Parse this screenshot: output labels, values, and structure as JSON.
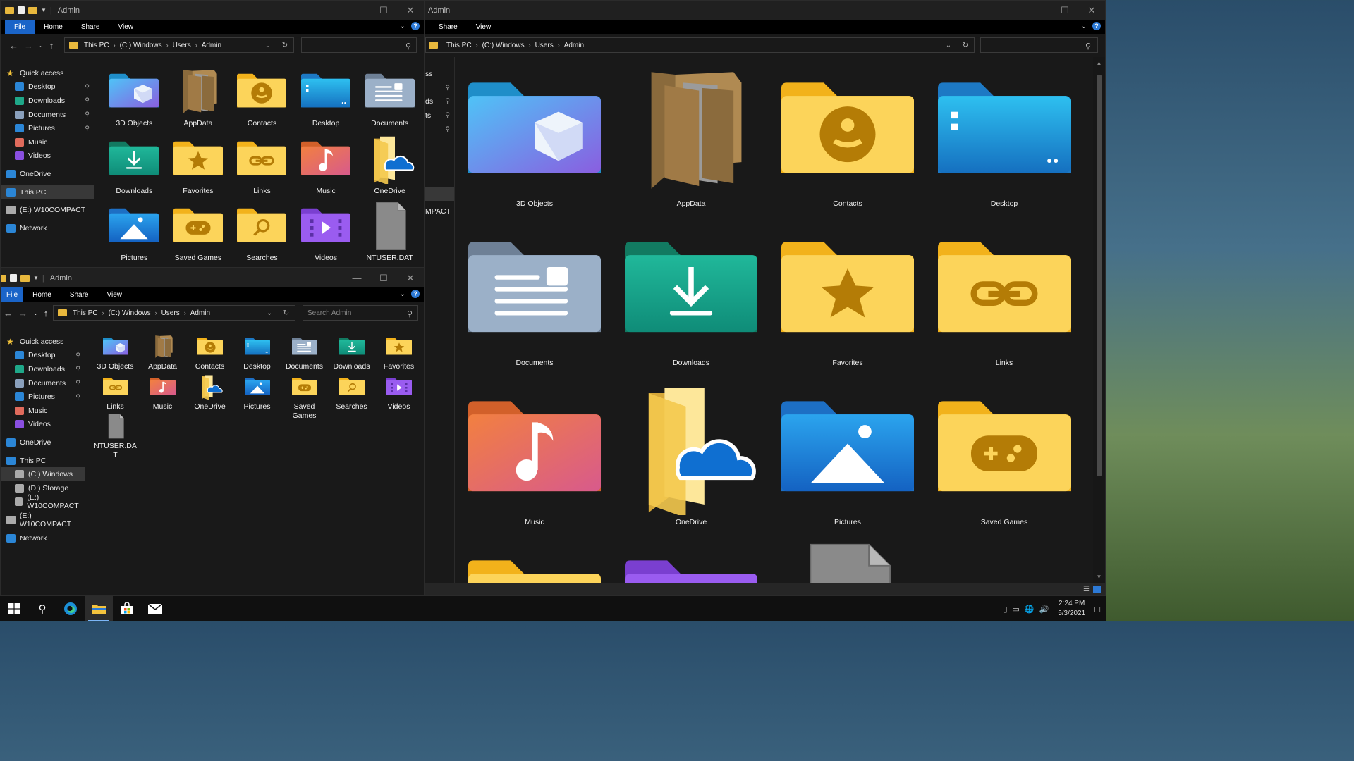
{
  "windows": {
    "w1": {
      "title": "Admin",
      "tabs": [
        "File",
        "Home",
        "Share",
        "View"
      ],
      "crumbs": [
        "This PC",
        "(C:) Windows",
        "Users",
        "Admin"
      ],
      "search_placeholder": ""
    },
    "w2": {
      "title": "Admin",
      "tabs": [
        "File",
        "Home",
        "Share",
        "View"
      ],
      "crumbs": [
        "This PC",
        "(C:) Windows",
        "Users",
        "Admin"
      ],
      "search_placeholder": "Search Admin"
    },
    "w3": {
      "title": "Admin",
      "tabs": [
        "Share",
        "View"
      ],
      "crumbs": [
        "This PC",
        "(C:) Windows",
        "Users",
        "Admin"
      ],
      "search_placeholder": ""
    }
  },
  "sidebar1": [
    {
      "label": "Quick access",
      "icon": "star-icon",
      "color": "#f3c33a",
      "indent": 0,
      "pin": false,
      "sel": false
    },
    {
      "label": "Desktop",
      "icon": "desktop-icon",
      "color": "#2b86d6",
      "indent": 1,
      "pin": true,
      "sel": false
    },
    {
      "label": "Downloads",
      "icon": "download-icon",
      "color": "#1fa889",
      "indent": 1,
      "pin": true,
      "sel": false
    },
    {
      "label": "Documents",
      "icon": "document-icon",
      "color": "#8aa0bc",
      "indent": 1,
      "pin": true,
      "sel": false
    },
    {
      "label": "Pictures",
      "icon": "picture-icon",
      "color": "#2b86d6",
      "indent": 1,
      "pin": true,
      "sel": false
    },
    {
      "label": "Music",
      "icon": "music-icon",
      "color": "#e06b5c",
      "indent": 1,
      "pin": false,
      "sel": false
    },
    {
      "label": "Videos",
      "icon": "video-icon",
      "color": "#8a4fe0",
      "indent": 1,
      "pin": false,
      "sel": false
    },
    {
      "gap": true
    },
    {
      "label": "OneDrive",
      "icon": "cloud-icon",
      "color": "#2b86d6",
      "indent": 0,
      "pin": false,
      "sel": false
    },
    {
      "gap": true
    },
    {
      "label": "This PC",
      "icon": "computer-icon",
      "color": "#2b86d6",
      "indent": 0,
      "pin": false,
      "sel": true
    },
    {
      "gap": true
    },
    {
      "label": "(E:) W10COMPACT",
      "icon": "drive-icon",
      "color": "#aaaaaa",
      "indent": 0,
      "pin": false,
      "sel": false
    },
    {
      "gap": true
    },
    {
      "label": "Network",
      "icon": "network-icon",
      "color": "#2b86d6",
      "indent": 0,
      "pin": false,
      "sel": false
    }
  ],
  "sidebar2": [
    {
      "label": "Quick access",
      "icon": "star-icon",
      "color": "#f3c33a",
      "indent": 0,
      "pin": false,
      "sel": false
    },
    {
      "label": "Desktop",
      "icon": "desktop-icon",
      "color": "#2b86d6",
      "indent": 1,
      "pin": true,
      "sel": false
    },
    {
      "label": "Downloads",
      "icon": "download-icon",
      "color": "#1fa889",
      "indent": 1,
      "pin": true,
      "sel": false
    },
    {
      "label": "Documents",
      "icon": "document-icon",
      "color": "#8aa0bc",
      "indent": 1,
      "pin": true,
      "sel": false
    },
    {
      "label": "Pictures",
      "icon": "picture-icon",
      "color": "#2b86d6",
      "indent": 1,
      "pin": true,
      "sel": false
    },
    {
      "label": "Music",
      "icon": "music-icon",
      "color": "#e06b5c",
      "indent": 1,
      "pin": false,
      "sel": false
    },
    {
      "label": "Videos",
      "icon": "video-icon",
      "color": "#8a4fe0",
      "indent": 1,
      "pin": false,
      "sel": false
    },
    {
      "gap": true
    },
    {
      "label": "OneDrive",
      "icon": "cloud-icon",
      "color": "#2b86d6",
      "indent": 0,
      "pin": false,
      "sel": false
    },
    {
      "gap": true
    },
    {
      "label": "This PC",
      "icon": "computer-icon",
      "color": "#2b86d6",
      "indent": 0,
      "pin": false,
      "sel": false
    },
    {
      "label": "(C:) Windows",
      "icon": "drive-icon",
      "color": "#aaaaaa",
      "indent": 1,
      "pin": false,
      "sel": true
    },
    {
      "label": "(D:) Storage",
      "icon": "drive-icon",
      "color": "#aaaaaa",
      "indent": 1,
      "pin": false,
      "sel": false
    },
    {
      "label": "(E:) W10COMPACT",
      "icon": "drive-icon",
      "color": "#aaaaaa",
      "indent": 1,
      "pin": false,
      "sel": false
    },
    {
      "gap": true
    },
    {
      "label": "(E:) W10COMPACT",
      "icon": "drive-icon",
      "color": "#aaaaaa",
      "indent": 0,
      "pin": false,
      "sel": false
    },
    {
      "gap": true
    },
    {
      "label": "Network",
      "icon": "network-icon",
      "color": "#2b86d6",
      "indent": 0,
      "pin": false,
      "sel": false
    }
  ],
  "sidebar3_fragments": [
    "ss",
    "ds",
    "ts",
    "MPACT"
  ],
  "files1": [
    {
      "label": "3D Objects",
      "kind": "3d"
    },
    {
      "label": "AppData",
      "kind": "appdata"
    },
    {
      "label": "Contacts",
      "kind": "contacts"
    },
    {
      "label": "Desktop",
      "kind": "desktop"
    },
    {
      "label": "Documents",
      "kind": "documents"
    },
    {
      "label": "Downloads",
      "kind": "downloads"
    },
    {
      "label": "Favorites",
      "kind": "favorites"
    },
    {
      "label": "Links",
      "kind": "links"
    },
    {
      "label": "Music",
      "kind": "music"
    },
    {
      "label": "OneDrive",
      "kind": "onedrive"
    },
    {
      "label": "Pictures",
      "kind": "pictures"
    },
    {
      "label": "Saved Games",
      "kind": "savedgames"
    },
    {
      "label": "Searches",
      "kind": "searches"
    },
    {
      "label": "Videos",
      "kind": "videos"
    },
    {
      "label": "NTUSER.DAT",
      "kind": "file"
    }
  ],
  "files2": [
    {
      "label": "3D Objects",
      "kind": "3d"
    },
    {
      "label": "AppData",
      "kind": "appdata"
    },
    {
      "label": "Contacts",
      "kind": "contacts"
    },
    {
      "label": "Desktop",
      "kind": "desktop"
    },
    {
      "label": "Documents",
      "kind": "documents"
    },
    {
      "label": "Downloads",
      "kind": "downloads"
    },
    {
      "label": "Favorites",
      "kind": "favorites"
    },
    {
      "label": "Links",
      "kind": "links"
    },
    {
      "label": "Music",
      "kind": "music"
    },
    {
      "label": "OneDrive",
      "kind": "onedrive"
    },
    {
      "label": "Pictures",
      "kind": "pictures"
    },
    {
      "label": "Saved\nGames",
      "kind": "savedgames"
    },
    {
      "label": "Searches",
      "kind": "searches"
    },
    {
      "label": "Videos",
      "kind": "videos"
    },
    {
      "label": "NTUSER.DA\nT",
      "kind": "file"
    }
  ],
  "files3": [
    {
      "label": "3D Objects",
      "kind": "3d"
    },
    {
      "label": "AppData",
      "kind": "appdata"
    },
    {
      "label": "Contacts",
      "kind": "contacts"
    },
    {
      "label": "Desktop",
      "kind": "desktop"
    },
    {
      "label": "Documents",
      "kind": "documents"
    },
    {
      "label": "Downloads",
      "kind": "downloads"
    },
    {
      "label": "Favorites",
      "kind": "favorites"
    },
    {
      "label": "Links",
      "kind": "links"
    },
    {
      "label": "Music",
      "kind": "music"
    },
    {
      "label": "OneDrive",
      "kind": "onedrive"
    },
    {
      "label": "Pictures",
      "kind": "pictures"
    },
    {
      "label": "Saved Games",
      "kind": "savedgames"
    },
    {
      "label": "",
      "kind": "searches"
    },
    {
      "label": "",
      "kind": "videos"
    },
    {
      "label": "",
      "kind": "file"
    }
  ],
  "taskbar": {
    "apps": [
      "start-icon",
      "search-icon",
      "edge-icon",
      "file-explorer-icon",
      "store-icon",
      "mail-icon"
    ],
    "time": "2:24 PM",
    "date": "5/3/2021"
  }
}
